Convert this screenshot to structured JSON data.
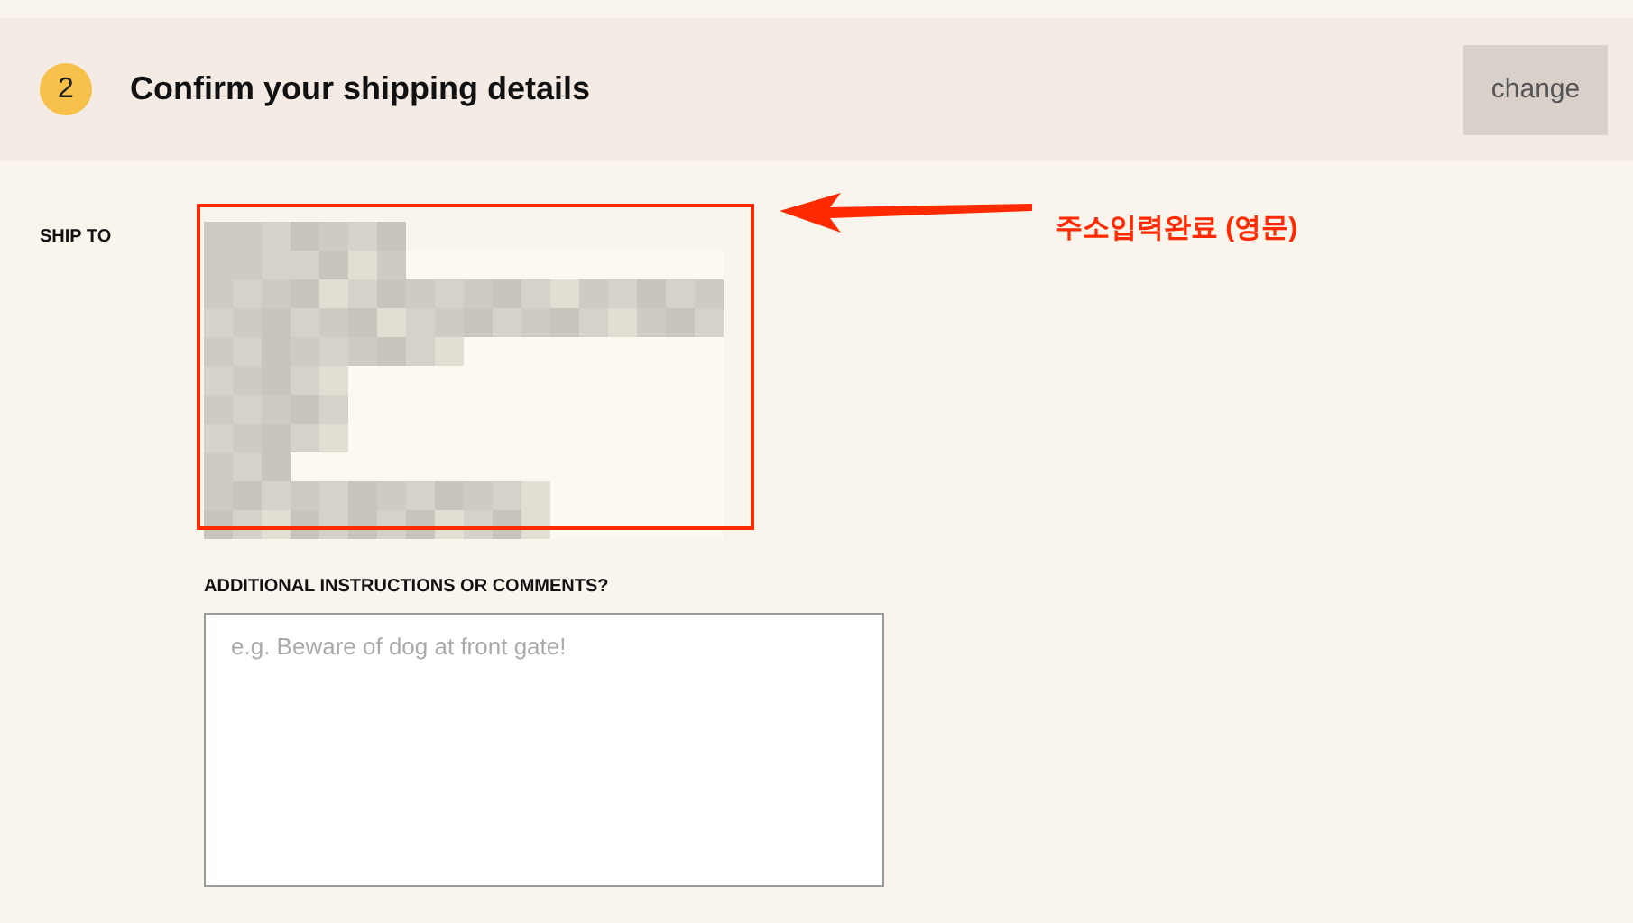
{
  "step": {
    "number": "2",
    "title": "Confirm your shipping details",
    "action": "change"
  },
  "ship_to": {
    "label": "SHIP TO"
  },
  "annotation": {
    "label": "주소입력완료 (영문)"
  },
  "comments": {
    "label": "ADDITIONAL INSTRUCTIONS OR COMMENTS?",
    "placeholder": "e.g. Beware of dog at front gate!"
  }
}
